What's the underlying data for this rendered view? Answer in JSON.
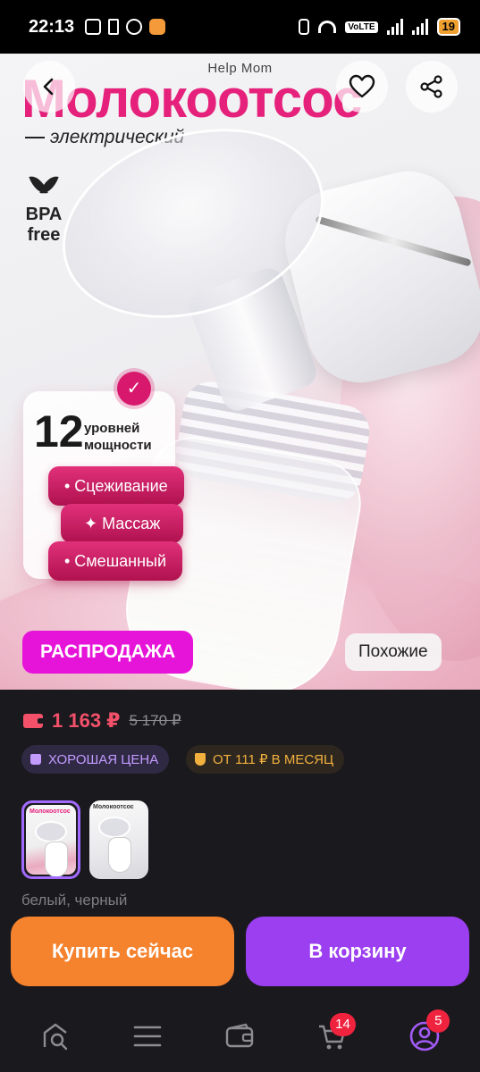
{
  "status_bar": {
    "time": "22:13",
    "battery": "19",
    "network": "VoLTE",
    "left_icons": [
      "nfc-icon",
      "bluetooth-icon",
      "chrome-icon",
      "app-heart-icon"
    ],
    "right_icons": [
      "vibrate-icon",
      "wifi-icon",
      "volte-badge",
      "signal-icon",
      "signal-icon",
      "battery-icon"
    ]
  },
  "hero": {
    "brand": "Help Mom",
    "title": "Молокоотсос",
    "subtitle": "электрический",
    "bpa_line1": "BPA",
    "bpa_line2": "free",
    "levels_number": "12",
    "levels_text": "уровней мощности",
    "modes": [
      "• Сцеживание",
      "✦ Массаж",
      "• Смешанный"
    ],
    "sale_label": "РАСПРОДАЖА",
    "similar_label": "Похожие",
    "buttons": [
      "back-icon",
      "heart-icon",
      "share-icon"
    ]
  },
  "product": {
    "price": "1 163 ₽",
    "old_price": "5 170 ₽",
    "badge_good": "ХОРОШАЯ ЦЕНА",
    "badge_credit": "ОТ 111 ₽ В МЕСЯЦ",
    "thumbnails": [
      {
        "title": "Молокоотсос",
        "selected": true
      },
      {
        "title": "Молокоотсос",
        "selected": false
      }
    ],
    "color_label": "белый, черный"
  },
  "actions": {
    "buy_now": "Купить сейчас",
    "add_to_cart": "В корзину"
  },
  "bottom_nav": {
    "items": [
      "search-icon",
      "menu-icon",
      "wallet-icon",
      "cart-icon",
      "profile-icon"
    ],
    "cart_badge": "14",
    "profile_badge": "5"
  },
  "colors": {
    "accent_purple": "#9b3ff0",
    "accent_orange": "#f5822d",
    "price_red": "#f3516a",
    "sale_magenta": "#e613d9",
    "brand_pink": "#e5217c"
  }
}
